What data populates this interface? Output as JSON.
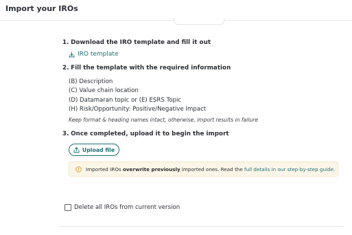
{
  "header": {
    "title": "Import your IROs"
  },
  "steps": [
    {
      "number": "1.",
      "label": "Download the IRO template and fill it out"
    },
    {
      "number": "2.",
      "label": "Fill the template with the required information"
    },
    {
      "number": "3.",
      "label": "Once completed, upload it to begin the import"
    }
  ],
  "template_link": {
    "label": "IRO template",
    "icon": "download-icon"
  },
  "required_fields": [
    "(B) Description",
    "(C) Value chain location",
    "(D) Datamaran topic or (E) ESRS Topic",
    "(H) Risk/Opportunity: Positive/Negative Impact"
  ],
  "hint": "Keep format & heading names intact, otherwise, import results in failure",
  "upload_button": {
    "label": "Upload file",
    "icon": "upload-icon"
  },
  "warning": {
    "icon": "info-circle-icon",
    "prefix": "Imported IROs ",
    "bold": "overwrite previously",
    "middle": " imported ones. Read the ",
    "link": "full details in our step-by-step guide",
    "suffix": "."
  },
  "delete_option": {
    "label": "Delete all IROs from current version",
    "checked": false
  },
  "colors": {
    "accent": "#1e6f73",
    "warning_bg": "#fcf6e9"
  }
}
